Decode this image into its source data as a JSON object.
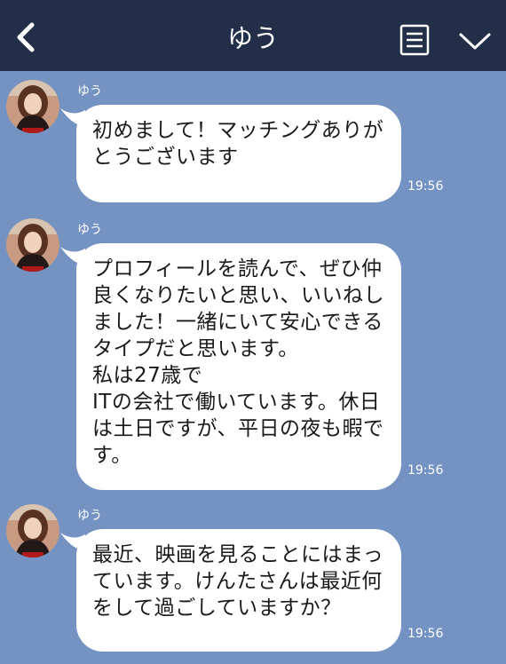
{
  "header": {
    "title": "ゆう",
    "back_icon": "chevron-left-icon",
    "menu_icon": "list-icon",
    "expand_icon": "chevron-down-icon"
  },
  "messages": [
    {
      "sender": "ゆう",
      "text": "初めまして！マッチングありがとうございます",
      "time": "19:56"
    },
    {
      "sender": "ゆう",
      "text": "プロフィールを読んで、ぜひ仲良くなりたいと思い、いいねしました！一緒にいて安心できるタイプだと思います。\n私は27歳で\nITの会社で働いています。休日は土日ですが、平日の夜も暇です。",
      "time": "19:56"
    },
    {
      "sender": "ゆう",
      "text": "最近、映画を見ることにはまっています。けんたさんは最近何をして過ごしていますか？",
      "time": "19:56"
    }
  ],
  "colors": {
    "header_bg": "#232e48",
    "chat_bg": "#7493c3",
    "bubble_bg": "#ffffff"
  }
}
